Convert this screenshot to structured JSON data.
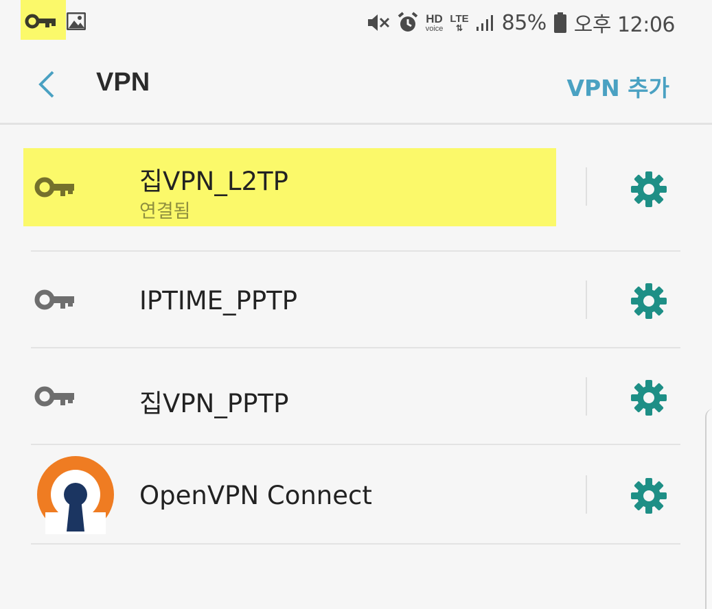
{
  "status_bar": {
    "battery": "85%",
    "time": "오후 12:06",
    "hd_top": "HD",
    "hd_bottom": "voice",
    "lte": "LTE"
  },
  "header": {
    "title": "VPN",
    "add_label": "VPN 추가"
  },
  "vpn_list": [
    {
      "name": "집VPN_L2TP",
      "status": "연결됨"
    },
    {
      "name": "IPTIME_PPTP"
    },
    {
      "name": "집VPN_PPTP"
    },
    {
      "name": "OpenVPN Connect"
    }
  ],
  "colors": {
    "accent": "#4aa1c2",
    "gear": "#1e8f86",
    "highlight": "#fbf96a",
    "key_gray": "#6e6e6e",
    "key_olive": "#75712c",
    "openvpn_orange": "#ef7c22",
    "openvpn_navy": "#1b3561"
  }
}
